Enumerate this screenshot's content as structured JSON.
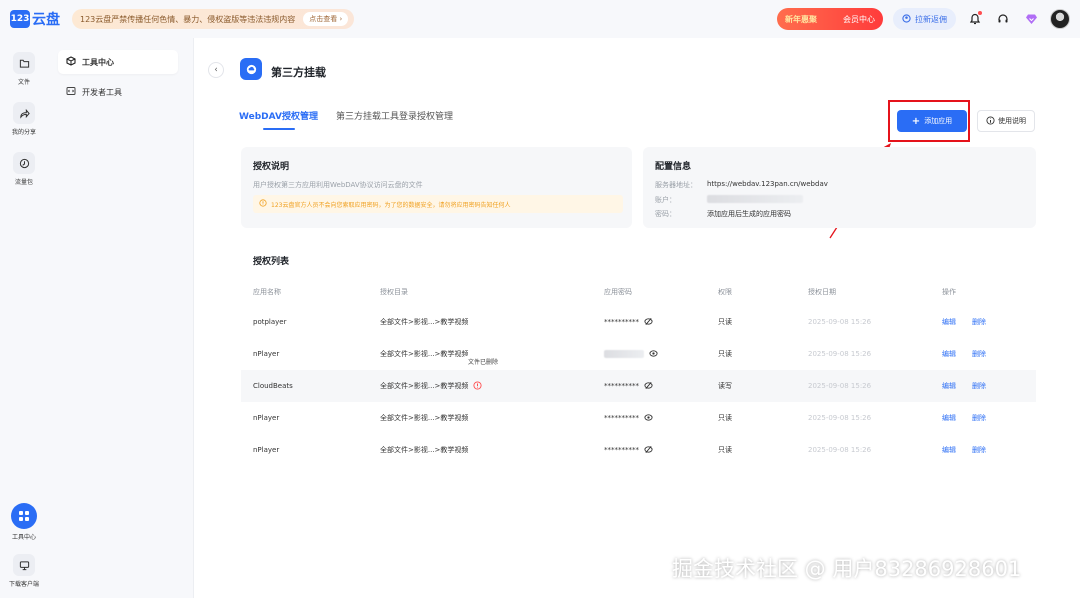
{
  "app": {
    "logo_badge": "123",
    "logo_text": "云盘"
  },
  "notice": {
    "text": "123云盘严禁传播任何色情、暴力、侵权盗版等违法违规内容",
    "button": "点击查看 ›"
  },
  "promo": {
    "left": "新年惠聚",
    "right": "会员中心"
  },
  "invite_label": "拉新返佣",
  "rail": [
    {
      "label": "文件",
      "icon": "folder-icon"
    },
    {
      "label": "我的分享",
      "icon": "share-icon"
    },
    {
      "label": "流量包",
      "icon": "traffic-icon"
    },
    {
      "label": "工具中心",
      "icon": "grid-icon"
    },
    {
      "label": "下载客户端",
      "icon": "monitor-icon"
    }
  ],
  "side": [
    {
      "label": "工具中心",
      "icon": "box-icon"
    },
    {
      "label": "开发者工具",
      "icon": "code-icon"
    }
  ],
  "page": {
    "title": "第三方挂载"
  },
  "tabs": [
    "WebDAV授权管理",
    "第三方挂载工具登录授权管理"
  ],
  "buttons": {
    "add": "添加应用",
    "help": "使用说明"
  },
  "auth_card": {
    "title": "授权说明",
    "desc": "用户授权第三方应用利用WebDAV协议访问云盘的文件",
    "warning": "123云盘官方人员不会向您索取应用密码，为了您的数据安全，请勿将应用密码告知任何人"
  },
  "config_card": {
    "title": "配置信息",
    "rows": [
      {
        "label": "服务器地址：",
        "value": "https://webdav.123pan.cn/webdav"
      },
      {
        "label": "账户：",
        "value": ""
      },
      {
        "label": "密码：",
        "value": "添加应用后生成的应用密码"
      }
    ]
  },
  "list": {
    "title": "授权列表",
    "headers": [
      "应用名称",
      "授权目录",
      "应用密码",
      "权限",
      "授权日期",
      "操作"
    ],
    "rows": [
      {
        "name": "potplayer",
        "dir": "全部文件>影视...>教学视频",
        "pwd": "**********",
        "perm": "只读",
        "date": "2025-09-08 15:26",
        "edit": "编辑",
        "del": "删除"
      },
      {
        "name": "nPlayer",
        "dir": "全部文件>影视...>教学视频",
        "pwd": "",
        "perm": "只读",
        "date": "2025-09-08 15:26",
        "edit": "编辑",
        "del": "删除"
      },
      {
        "name": "CloudBeats",
        "dir": "全部文件>影视...>教学视频",
        "pwd": "**********",
        "perm": "读写",
        "date": "2025-09-08 15:26",
        "edit": "编辑",
        "del": "删除"
      },
      {
        "name": "nPlayer",
        "dir": "全部文件>影视...>教学视频",
        "pwd": "**********",
        "perm": "只读",
        "date": "2025-09-08 15:26",
        "edit": "编辑",
        "del": "删除"
      },
      {
        "name": "nPlayer",
        "dir": "全部文件>影视...>教学视频",
        "pwd": "**********",
        "perm": "只读",
        "date": "2025-09-08 15:26",
        "edit": "编辑",
        "del": "删除"
      }
    ],
    "tooltip": "文件已删除"
  },
  "watermark": "掘金技术社区 @ 用户83286928601",
  "colors": {
    "accent": "#2a6df5",
    "highlight": "#e5131b",
    "warning": "#f0a020"
  }
}
